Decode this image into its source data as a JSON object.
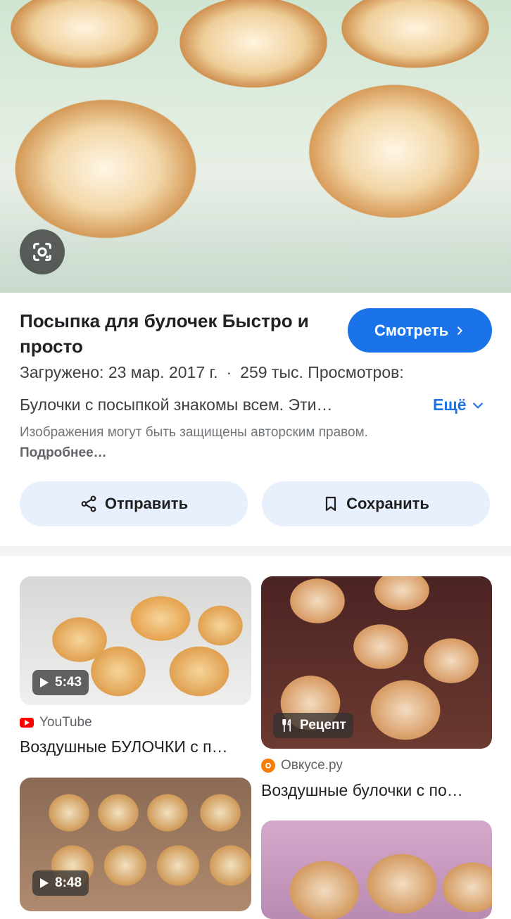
{
  "main_result": {
    "title": "Посыпка для булочек Быстро и просто",
    "watch_label": "Смотреть",
    "uploaded": "Загружено: 23 мар. 2017 г.",
    "separator": "·",
    "views": "259 тыс. Просмотров:",
    "description": "Булочки с посыпкой знакомы всем. Эти…",
    "more_label": "Ещё",
    "copyright_text": "Изображения могут быть защищены авторским правом.",
    "copyright_link": "Подробнее…",
    "share_label": "Отправить",
    "save_label": "Сохранить"
  },
  "related": [
    {
      "badge": "5:43",
      "source": "YouTube",
      "caption": "Воздушные БУЛОЧКИ с п…"
    },
    {
      "badge": "Рецепт",
      "source": "Овкусе.ру",
      "caption": "Воздушные булочки с по…"
    },
    {
      "badge": "8:48",
      "source": "",
      "caption": ""
    }
  ],
  "colors": {
    "accent": "#1a73e8",
    "chip_bg": "#e8f0fe"
  }
}
